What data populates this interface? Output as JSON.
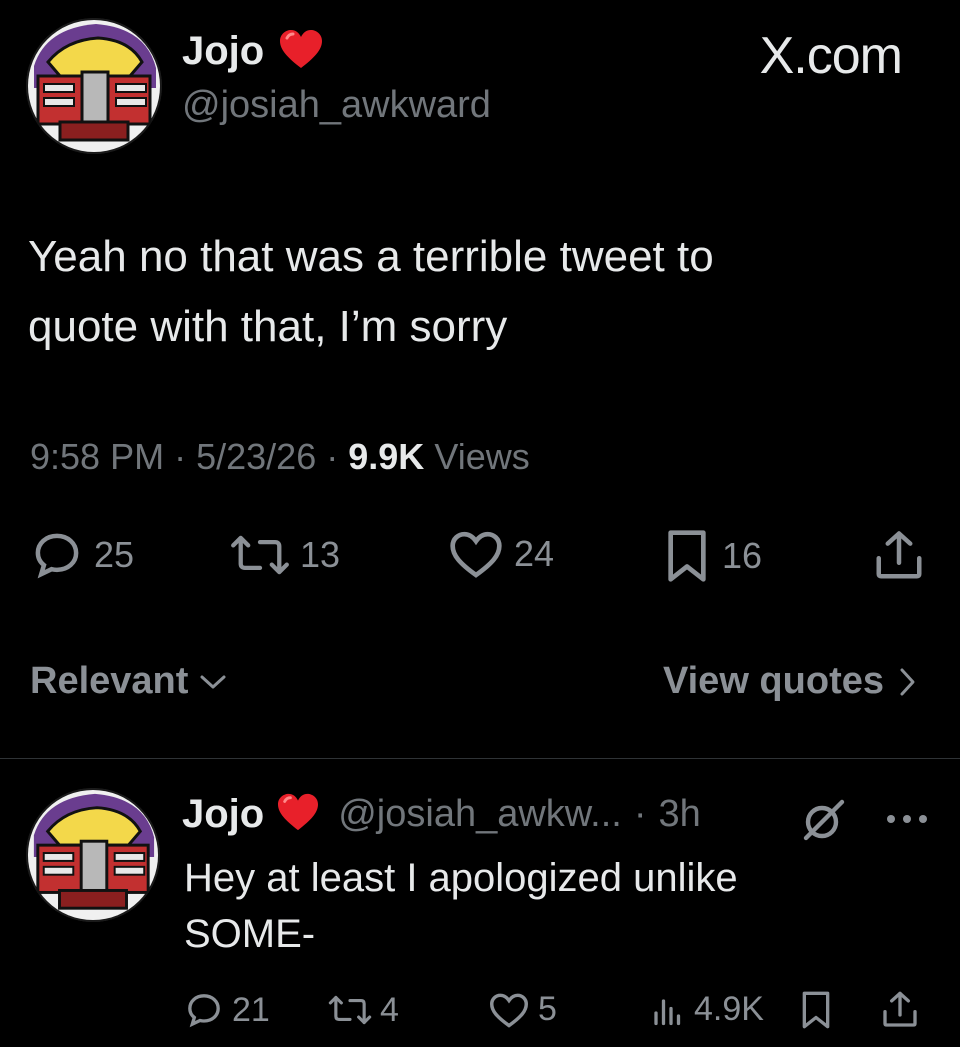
{
  "header": {
    "display_name": "Jojo",
    "handle": "@josiah_awkward",
    "brand": "X.com"
  },
  "tweet": {
    "text_line1": "Yeah no that was a terrible tweet to",
    "text_line2": "quote with that, I’m sorry",
    "time": "9:58 PM",
    "sep1": "·",
    "date": "5/23/26",
    "sep2": "·",
    "views_count": "9.9K",
    "views_label": "Views",
    "replies": "25",
    "reposts": "13",
    "likes": "24",
    "bookmarks": "16"
  },
  "filters": {
    "sort_label": "Relevant",
    "view_quotes_label": "View quotes"
  },
  "reply": {
    "display_name": "Jojo",
    "handle": "@josiah_awkw...",
    "sep": "·",
    "time": "3h",
    "text_line1": "Hey at least I apologized unlike",
    "text_line2": "SOME-",
    "replies": "21",
    "reposts": "4",
    "likes": "5",
    "views": "4.9K"
  },
  "colors": {
    "background": "#000000",
    "text": "#e7e9ea",
    "muted": "#71767b",
    "heart": "#e8202a",
    "divider": "#2f3336"
  },
  "icons": [
    "heart-emoji-icon",
    "reply-icon",
    "repost-icon",
    "like-icon",
    "bookmark-icon",
    "share-icon",
    "chevron-down-icon",
    "chevron-right-icon",
    "grok-icon",
    "more-icon",
    "views-icon"
  ]
}
